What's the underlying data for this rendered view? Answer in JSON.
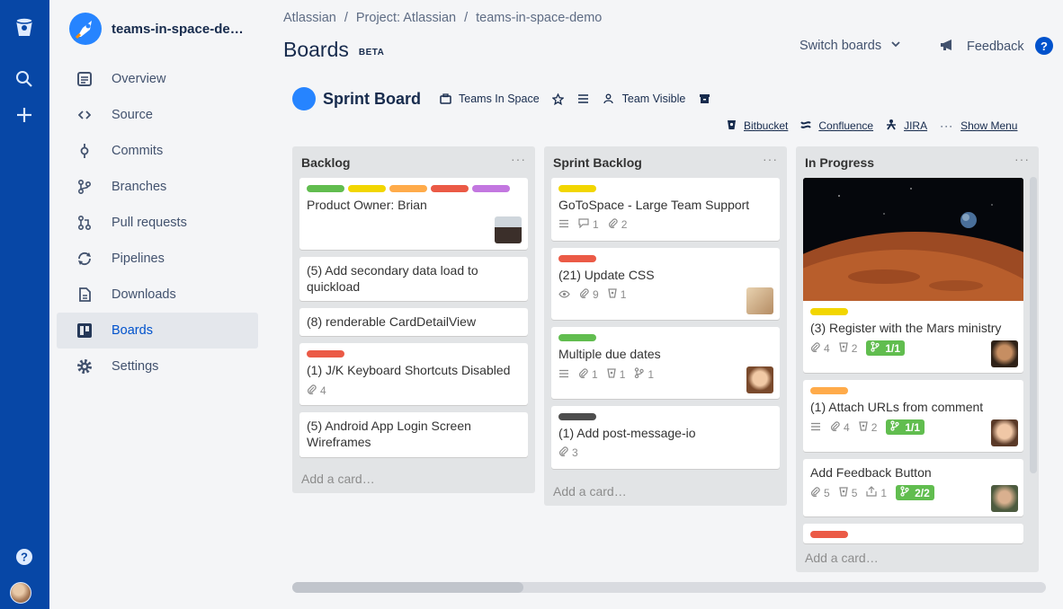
{
  "sidebar": {
    "repo_name": "teams-in-space-demo",
    "items": [
      {
        "label": "Overview",
        "icon": "overview-icon"
      },
      {
        "label": "Source",
        "icon": "code-icon"
      },
      {
        "label": "Commits",
        "icon": "commit-icon"
      },
      {
        "label": "Branches",
        "icon": "branch-icon"
      },
      {
        "label": "Pull requests",
        "icon": "pull-request-icon"
      },
      {
        "label": "Pipelines",
        "icon": "pipelines-icon"
      },
      {
        "label": "Downloads",
        "icon": "file-icon"
      },
      {
        "label": "Boards",
        "icon": "board-icon"
      },
      {
        "label": "Settings",
        "icon": "gear-icon"
      }
    ]
  },
  "breadcrumb": [
    "Atlassian",
    "Project: Atlassian",
    "teams-in-space-demo"
  ],
  "header": {
    "title": "Boards",
    "beta": "BETA",
    "switch_boards": "Switch boards",
    "feedback": "Feedback",
    "help": "?"
  },
  "board": {
    "name": "Sprint Board",
    "team": "Teams In Space",
    "visibility": "Team Visible",
    "powerups": [
      "Bitbucket",
      "Confluence",
      "JIRA",
      "Show Menu"
    ]
  },
  "colors": {
    "green": "#61bd4f",
    "yellow": "#f2d600",
    "orange": "#ffab4a",
    "red": "#eb5a46",
    "purple": "#c377e0",
    "dark": "#4d4d4d"
  },
  "lists": [
    {
      "title": "Backlog",
      "add_card": "Add a card…",
      "cards": [
        {
          "title": "Product Owner: Brian"
        },
        {
          "title": "(5) Add secondary data load to quickload"
        },
        {
          "title": "(8) renderable CardDetailView"
        },
        {
          "title": "(1) J/K Keyboard Shortcuts Disabled",
          "attachments": "4"
        },
        {
          "title": "(5) Android App Login Screen Wireframes"
        }
      ]
    },
    {
      "title": "Sprint Backlog",
      "add_card": "Add a card…",
      "cards": [
        {
          "title": "GoToSpace - Large Team Support",
          "comments": "1",
          "attachments": "2"
        },
        {
          "title": "(21) Update CSS",
          "attachments": "9",
          "bitbucket": "1"
        },
        {
          "title": "Multiple due dates",
          "attachments": "1",
          "bitbucket": "1",
          "branches": "1"
        },
        {
          "title": "(1) Add post-message-io",
          "attachments": "3"
        }
      ]
    },
    {
      "title": "In Progress",
      "add_card": "Add a card…",
      "cards": [
        {
          "title": "(3) Register with the Mars ministry",
          "attachments": "4",
          "bitbucket": "2",
          "pr": "1/1"
        },
        {
          "title": "(1) Attach URLs from comment",
          "attachments": "4",
          "bitbucket": "2",
          "pr": "1/1"
        },
        {
          "title": "Add Feedback Button",
          "attachments": "5",
          "bitbucket": "5",
          "builds": "1",
          "pr": "2/2"
        }
      ]
    }
  ],
  "menu_dots": "···"
}
